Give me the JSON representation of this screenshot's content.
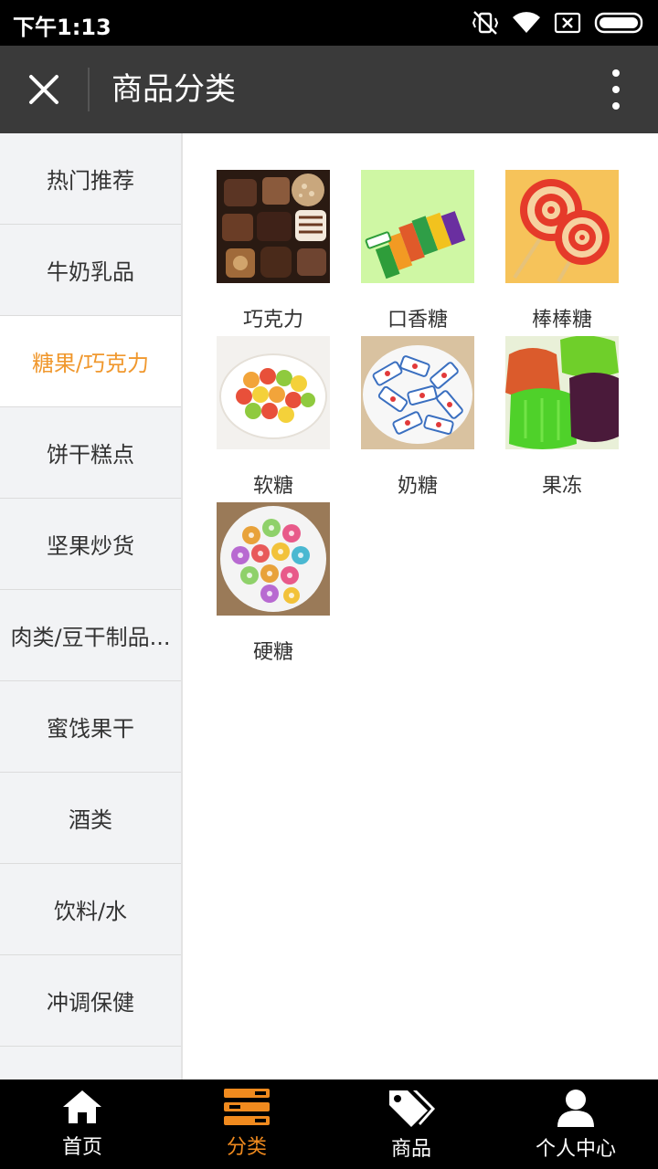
{
  "status_bar": {
    "time": "下午1:13"
  },
  "header": {
    "title": "商品分类"
  },
  "sidebar": {
    "items": [
      {
        "label": "热门推荐"
      },
      {
        "label": "牛奶乳品"
      },
      {
        "label": "糖果/巧克力"
      },
      {
        "label": "饼干糕点"
      },
      {
        "label": "坚果炒货"
      },
      {
        "label": "肉类/豆干制品..."
      },
      {
        "label": "蜜饯果干"
      },
      {
        "label": "酒类"
      },
      {
        "label": "饮料/水"
      },
      {
        "label": "冲调保健"
      }
    ],
    "active_index": 2
  },
  "products": [
    {
      "name": "巧克力",
      "icon": "chocolate-image"
    },
    {
      "name": "口香糖",
      "icon": "chewing-gum-image"
    },
    {
      "name": "棒棒糖",
      "icon": "lollipop-image"
    },
    {
      "name": "软糖",
      "icon": "soft-candy-image"
    },
    {
      "name": "奶糖",
      "icon": "milk-candy-image"
    },
    {
      "name": "果冻",
      "icon": "jelly-image"
    },
    {
      "name": "硬糖",
      "icon": "hard-candy-image"
    }
  ],
  "bottom_nav": {
    "tabs": [
      {
        "label": "首页",
        "icon": "home-icon"
      },
      {
        "label": "分类",
        "icon": "category-icon"
      },
      {
        "label": "商品",
        "icon": "tag-icon"
      },
      {
        "label": "个人中心",
        "icon": "user-icon"
      }
    ],
    "active_index": 1
  },
  "colors": {
    "accent": "#f0982e",
    "header_bg": "#3a3a3a",
    "sidebar_bg": "#f2f3f5"
  }
}
